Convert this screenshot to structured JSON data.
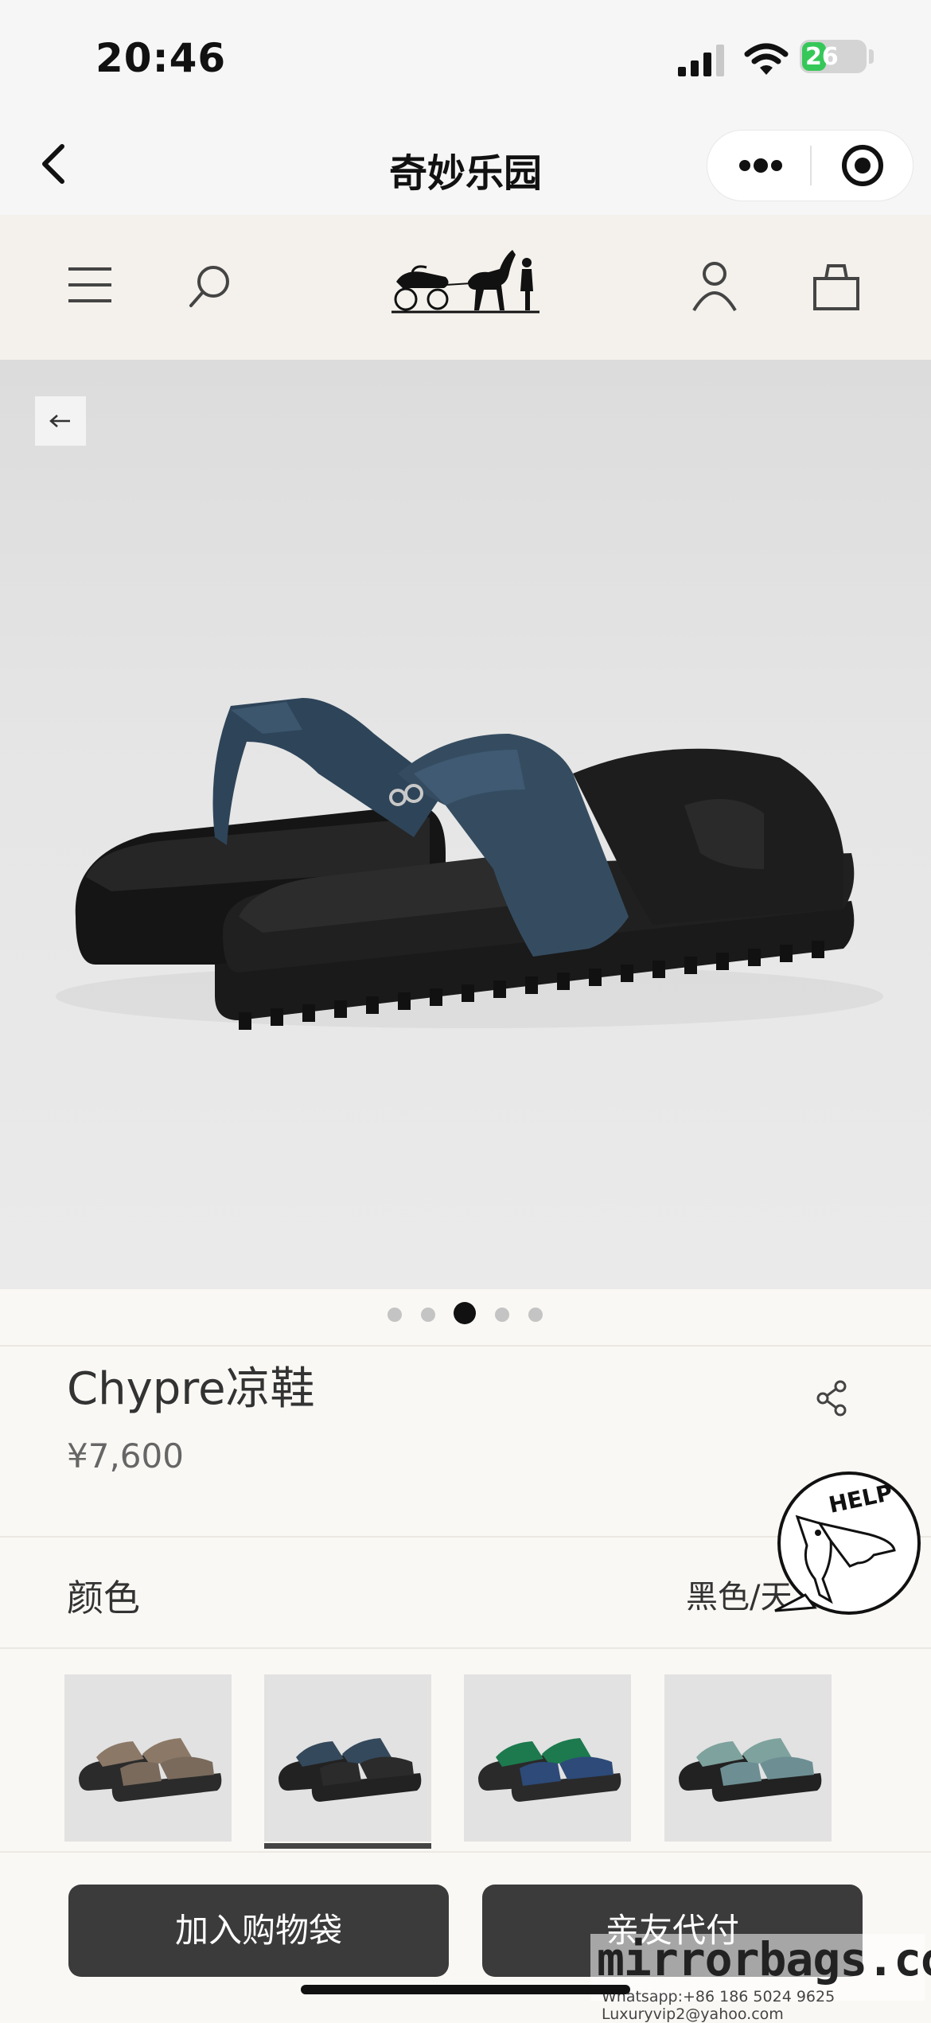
{
  "status_bar": {
    "time": "20:46",
    "battery": "26"
  },
  "mini_program": {
    "title": "奇妙乐园"
  },
  "product": {
    "name": "Chypre凉鞋",
    "price": "¥7,600",
    "color_label": "颜色",
    "color_value": "黑色/天",
    "images_total": 5,
    "images_active_index": 2
  },
  "swatches": [
    {
      "name": "taupe",
      "strap": "#8b7866",
      "body": "#7a6a5c",
      "sole": "#2b2b2b"
    },
    {
      "name": "navy-black",
      "strap": "#34495b",
      "body": "#2b2b2b",
      "sole": "#222222"
    },
    {
      "name": "green-blue",
      "strap": "#1c7a4e",
      "body": "#2d4a78",
      "sole": "#2a2a2a"
    },
    {
      "name": "sage-teal",
      "strap": "#7ea29d",
      "body": "#6d8f94",
      "sole": "#222222"
    }
  ],
  "help_badge": {
    "text": "HELP"
  },
  "buttons": {
    "add_to_bag": "加入购物袋",
    "pay_for_me": "亲友代付"
  },
  "watermark": {
    "site": "mirrorbags.com",
    "contact": "Whatsapp:+86 186 5024 9625   Luxuryvip2@yahoo.com"
  },
  "colors": {
    "button_bg": "#3b3b3b",
    "page_bg": "#faf8f4",
    "header_bg": "#f4f1ec"
  }
}
